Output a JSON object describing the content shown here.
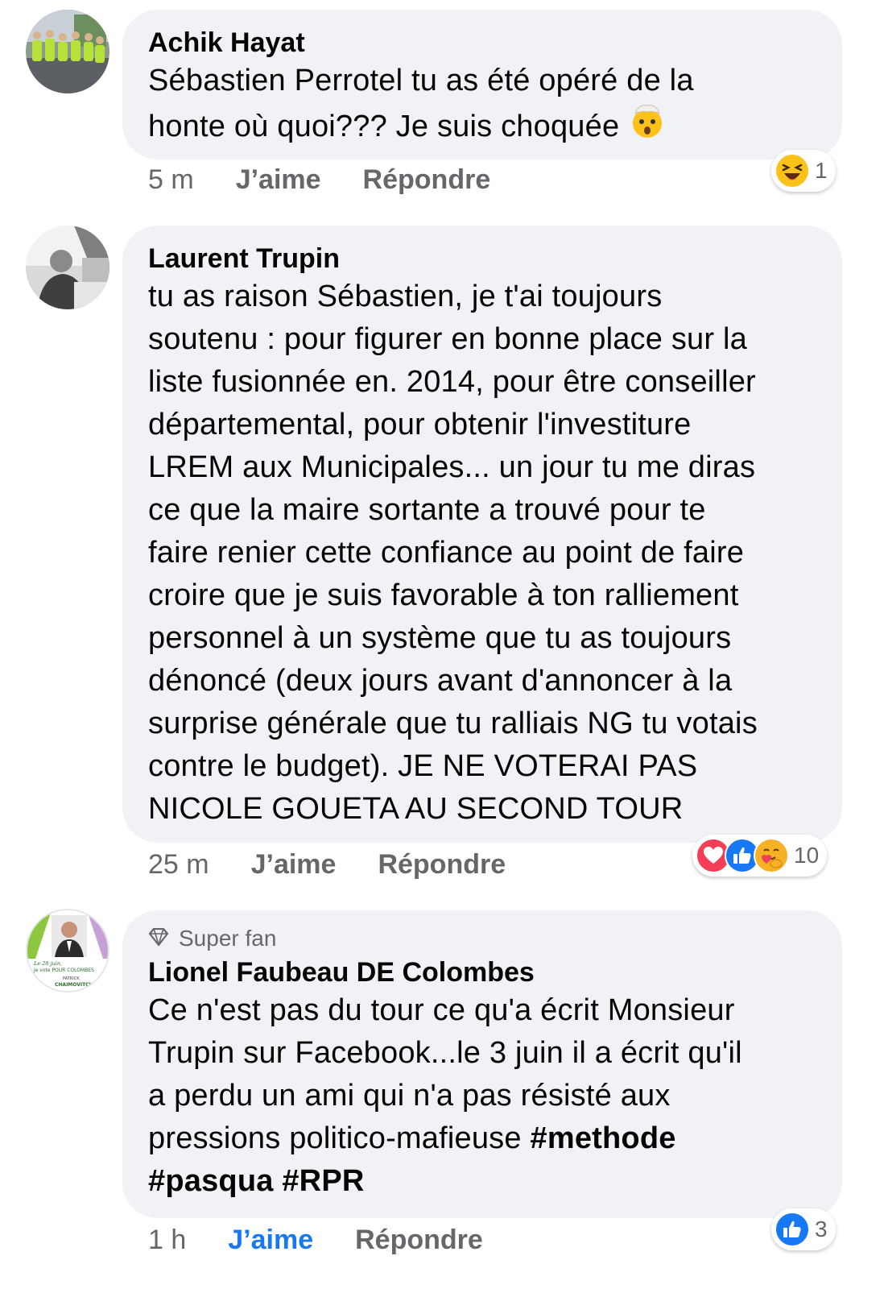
{
  "comments": [
    {
      "author": "Achik Hayat",
      "lines": [
        "Sébastien Perrotel tu as été opéré de la",
        "honte où quoi??? Je suis choquée"
      ],
      "time": "5 m",
      "like_label": "J’aime",
      "reply_label": "Répondre",
      "reaction_count": "1",
      "reaction_icons": [
        "laughing-emoji-icon"
      ]
    },
    {
      "author": "Laurent Trupin",
      "lines": [
        "tu as raison Sébastien, je t'ai toujours",
        "soutenu : pour figurer en bonne place sur la",
        "liste fusionnée en. 2014, pour être conseiller",
        "départemental, pour obtenir l'investiture",
        "LREM aux Municipales... un jour tu me diras",
        "ce que la maire sortante a trouvé pour te",
        "faire renier cette confiance au point de faire",
        "croire que je suis favorable à ton ralliement",
        "personnel à un système que tu as toujours",
        "dénoncé (deux jours avant d'annoncer à la",
        "surprise générale que tu ralliais NG tu votais",
        "contre le budget). JE NE VOTERAI PAS",
        "NICOLE GOUETA AU SECOND TOUR"
      ],
      "time": "25 m",
      "like_label": "J’aime",
      "reply_label": "Répondre",
      "reaction_count": "10",
      "reaction_icons": [
        "love-heart-icon",
        "like-thumb-icon",
        "care-hug-icon"
      ]
    },
    {
      "badge": "Super fan",
      "author": "Lionel Faubeau DE Colombes",
      "lines": [
        "Ce n'est pas du tour ce qu'a écrit Monsieur",
        "Trupin sur Facebook...le 3 juin il a écrit qu'il",
        "a perdu un ami qui n'a pas résisté aux",
        "pressions politico-mafieuse"
      ],
      "hashtags_inline": "#methode",
      "hashtags_line": [
        "#pasqua",
        "#RPR"
      ],
      "time": "1 h",
      "like_label": "J’aime",
      "reply_label": "Répondre",
      "reaction_count": "3",
      "reaction_icons": [
        "like-thumb-icon"
      ],
      "avatar_text": {
        "line1": "Le 28 juin,",
        "line2": "je vote POUR COLOMBES",
        "line3": "PATRICK",
        "line4": "CHAIMOVITCH"
      }
    }
  ],
  "colors": {
    "bubble": "#f0f2f5",
    "meta": "#65676b",
    "like_active": "#1877f2",
    "text": "#050505"
  }
}
